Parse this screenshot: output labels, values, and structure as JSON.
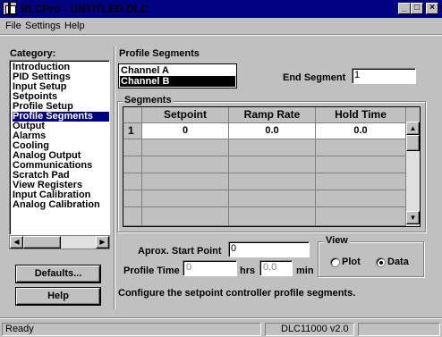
{
  "window": {
    "title": "RLCPro - UNTITLED.DLC"
  },
  "menu": {
    "file": "File",
    "settings": "Settings",
    "help": "Help"
  },
  "category": {
    "label": "Category:",
    "items": [
      "Introduction",
      "PID Settings",
      "Input Setup",
      "Setpoints",
      "Profile Setup",
      "Profile Segments",
      "Output",
      "Alarms",
      "Cooling",
      "Analog Output",
      "Communications",
      "Scratch Pad",
      "View Registers",
      "Input Calibration",
      "Analog Calibration"
    ],
    "selected": "Profile Segments"
  },
  "buttons": {
    "defaults": "Defaults...",
    "help": "Help"
  },
  "panel": {
    "title": "Profile Segments",
    "channels": [
      "Channel A",
      "Channel B"
    ],
    "selected_channel": "Channel B",
    "end_segment_label": "End Segment",
    "end_segment_value": "1",
    "segments_label": "Segments",
    "columns": [
      "Setpoint",
      "Ramp Rate",
      "Hold Time"
    ],
    "rows": [
      {
        "num": "1",
        "setpoint": "0",
        "ramp_rate": "0.0",
        "hold_time": "0.0"
      }
    ],
    "start_point_label": "Aprox. Start Point",
    "start_point_value": "0",
    "profile_time_label": "Profile Time",
    "hrs_value": "0",
    "hrs_label": "hrs",
    "min_value": "0.0",
    "min_label": "min",
    "view_label": "View",
    "view_plot": "Plot",
    "view_data": "Data",
    "view_selected": "Data",
    "description": "Configure the setpoint controller profile segments."
  },
  "status": {
    "left": "Ready",
    "version": "DLC11000 v2.0"
  }
}
